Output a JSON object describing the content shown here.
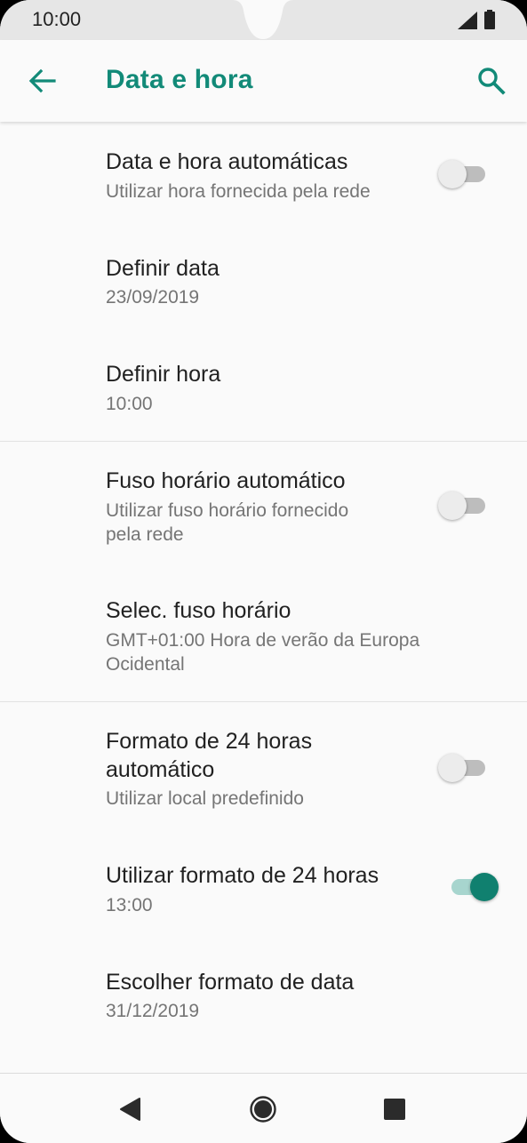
{
  "status_bar": {
    "time": "10:00"
  },
  "app_bar": {
    "title": "Data e hora"
  },
  "settings": {
    "auto_datetime": {
      "title": "Data e hora automáticas",
      "summary": "Utilizar hora fornecida pela rede",
      "switch_on": false
    },
    "set_date": {
      "title": "Definir data",
      "summary": "23/09/2019"
    },
    "set_time": {
      "title": "Definir hora",
      "summary": "10:00"
    },
    "auto_timezone": {
      "title": "Fuso horário automático",
      "summary_line1": "Utilizar fuso horário fornecido",
      "summary_line2": "pela rede",
      "switch_on": false
    },
    "select_timezone": {
      "title": "Selec. fuso horário",
      "summary_line1": "GMT+01:00 Hora de verão da Europa",
      "summary_line2": "Ocidental"
    },
    "auto_24h": {
      "title_line1": "Formato de 24 horas",
      "title_line2": "automático",
      "summary": "Utilizar local predefinido",
      "switch_on": false
    },
    "use_24h": {
      "title": "Utilizar formato de 24 horas",
      "summary": "13:00",
      "switch_on": true
    },
    "date_format": {
      "title": "Escolher formato de data",
      "summary": "31/12/2019"
    }
  },
  "icons": {
    "back": "arrow-left-icon",
    "search": "search-icon",
    "nav_back": "triangle-back-icon",
    "nav_home": "circle-home-icon",
    "nav_recents": "square-recents-icon"
  },
  "colors": {
    "accent": "#128a78",
    "switch_on_thumb": "#10806f",
    "switch_on_track": "#a7d5ce"
  }
}
